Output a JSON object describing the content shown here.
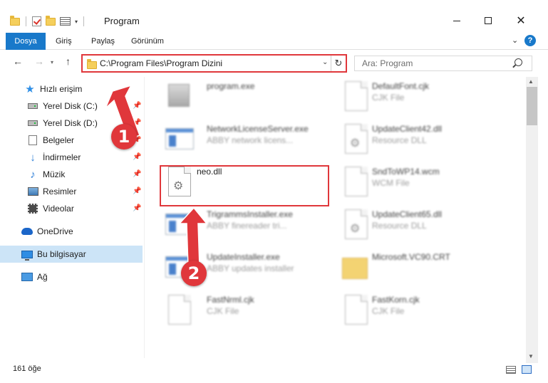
{
  "window": {
    "title": "Program",
    "minimize_icon": "minimize-icon",
    "maximize_icon": "maximize-icon",
    "close_glyph": "✕"
  },
  "ribbon": {
    "tabs": [
      {
        "label": "Dosya",
        "active": true
      },
      {
        "label": "Giriş"
      },
      {
        "label": "Paylaş"
      },
      {
        "label": "Görünüm"
      }
    ],
    "help_label": "?",
    "accent": "#1979ca"
  },
  "address": {
    "path": "C:\\Program Files\\Program Dizini",
    "refresh_glyph": "↻",
    "search_placeholder": "Ara: Program",
    "highlight_color": "#e0373b"
  },
  "sidebar": {
    "items": [
      {
        "label": "Hızlı erişim",
        "icon": "star-icon"
      },
      {
        "label": "Yerel Disk (C:)",
        "icon": "disk-icon",
        "pinned": true
      },
      {
        "label": "Yerel Disk (D:)",
        "icon": "disk-icon",
        "pinned": true
      },
      {
        "label": "Belgeler",
        "icon": "document-icon",
        "pinned": true
      },
      {
        "label": "İndirmeler",
        "icon": "download-icon",
        "pinned": true
      },
      {
        "label": "Müzik",
        "icon": "music-icon",
        "pinned": true
      },
      {
        "label": "Resimler",
        "icon": "pictures-icon",
        "pinned": true
      },
      {
        "label": "Videolar",
        "icon": "video-icon",
        "pinned": true
      },
      {
        "label": "OneDrive",
        "icon": "onedrive-icon"
      },
      {
        "label": "Bu bilgisayar",
        "icon": "computer-icon",
        "selected": true
      },
      {
        "label": "Ağ",
        "icon": "network-icon"
      }
    ]
  },
  "files": {
    "left": [
      {
        "name": "program.exe",
        "type": "",
        "icon": "program-icon"
      },
      {
        "name": "NetworkLicenseServer.exe",
        "type": "ABBY network licens...",
        "icon": "exe-icon"
      },
      {
        "name": "neo.dll",
        "type": "",
        "icon": "dll-icon",
        "highlighted": true
      },
      {
        "name": "TrigrammsInstaller.exe",
        "type": "ABBY finereader tri...",
        "icon": "exe-icon"
      },
      {
        "name": "UpdateInstaller.exe",
        "type": "ABBY updates installer",
        "icon": "exe-icon"
      },
      {
        "name": "FastNrml.cjk",
        "type": "CJK File",
        "icon": "file-icon"
      }
    ],
    "right": [
      {
        "name": "DefaultFont.cjk",
        "type": "CJK File",
        "icon": "file-icon"
      },
      {
        "name": "UpdateClient42.dll",
        "type": "Resource DLL",
        "icon": "dll-icon"
      },
      {
        "name": "SndToWP14.wcm",
        "type": "WCM File",
        "icon": "file-icon"
      },
      {
        "name": "UpdateClient65.dll",
        "type": "Resource DLL",
        "icon": "dll-icon"
      },
      {
        "name": "Microsoft.VC90.CRT",
        "type": "",
        "icon": "folder-icon"
      },
      {
        "name": "FastKorn.cjk",
        "type": "CJK File",
        "icon": "file-icon"
      }
    ]
  },
  "status": {
    "item_count": "161 öğe"
  },
  "annotations": {
    "marker_1": "1",
    "marker_2": "2",
    "color": "#e0373b"
  }
}
